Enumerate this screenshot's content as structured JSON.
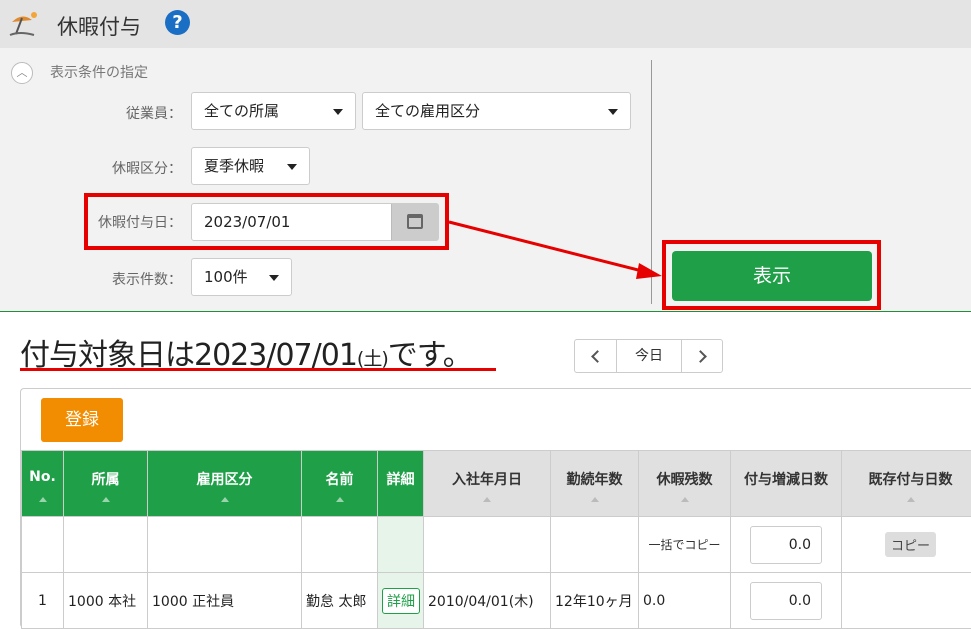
{
  "header": {
    "title": "休暇付与",
    "help": "?",
    "app_icon": "beach-umbrella-icon"
  },
  "filter": {
    "section_label": "表示条件の指定",
    "employee_label": "従業員：",
    "department_value": "全ての所属",
    "employment_type_value": "全ての雇用区分",
    "leave_type_label": "休暇区分：",
    "leave_type_value": "夏季休暇",
    "grant_date_label": "休暇付与日：",
    "grant_date_value": "2023/07/01",
    "count_label": "表示件数：",
    "count_value": "100件",
    "show_button": "表示"
  },
  "headline": {
    "main": "付与対象日は2023/07/01",
    "weekday": "(土)",
    "tail": "です。"
  },
  "nav": {
    "today": "今日"
  },
  "register_button": "登録",
  "table": {
    "headers": [
      "No.",
      "所属",
      "雇用区分",
      "名前",
      "詳細",
      "入社年月日",
      "勤続年数",
      "休暇残数",
      "付与増減日数",
      "既存付与日数"
    ],
    "bulk_row": {
      "bulk_copy_label": "一括でコピー",
      "value": "0.0",
      "copy_button": "コピー"
    },
    "rows": [
      {
        "no": "1",
        "department": "1000 本社",
        "employment_type": "1000 正社員",
        "name": "勤怠 太郎",
        "detail": "詳細",
        "hire_date": "2010/04/01(木)",
        "tenure": "12年10ヶ月",
        "leave_balance": "0.0",
        "grant_adjust": "0.0",
        "existing_grant": ""
      }
    ]
  },
  "colors": {
    "accent_green": "#1fa048",
    "annotation_red": "#e60000",
    "register_orange": "#f28c00",
    "help_blue": "#1a6fc4"
  }
}
